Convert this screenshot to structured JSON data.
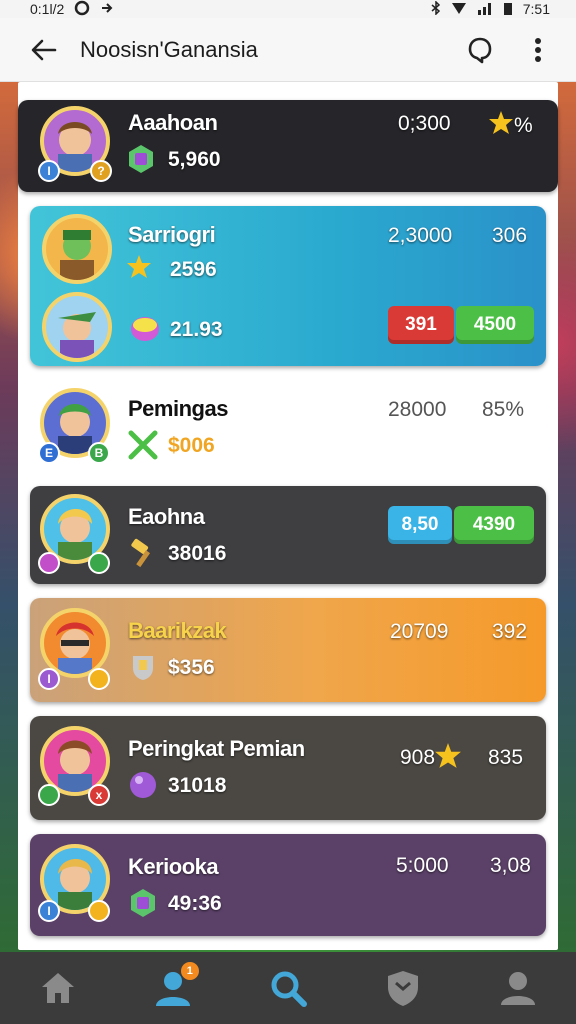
{
  "status_bar": {
    "time": "0:1l/2",
    "battery_text": "7:51"
  },
  "app_bar": {
    "title": "Noosisn'Ganansia"
  },
  "rows": [
    {
      "name": "Aaahoan",
      "sub_value": "5,960",
      "score": "0;300",
      "pct": "%",
      "badge_left": "I",
      "badge_right": "?"
    },
    {
      "name": "Sarriogri",
      "sub_value": "2596",
      "score": "2,3000",
      "pct": "306",
      "sub2_value": "21.93",
      "pill_red": "391",
      "pill_green": "4500",
      "badge_left": "",
      "badge_right": ""
    },
    {
      "name": "Pemingas",
      "sub_value": "$006",
      "score": "28000",
      "pct": "85%",
      "badge_left": "E",
      "badge_right": "B"
    },
    {
      "name": "Eaohna",
      "sub_value": "38016",
      "pill_blue": "8,50",
      "pill_green": "4390",
      "badge_left": "",
      "badge_right": ""
    },
    {
      "name": "Baarikzak",
      "sub_value": "$356",
      "score": "20709",
      "pct": "392",
      "badge_left": "I",
      "badge_right": ""
    },
    {
      "name": "Peringkat Pemian",
      "sub_value": "31018",
      "score": "908",
      "pct": "835",
      "badge_left": "",
      "badge_right": "x"
    },
    {
      "name": "Keriooka",
      "sub_value": "49:36",
      "score": "5:000",
      "pct": "3,08",
      "badge_left": "I",
      "badge_right": ""
    }
  ],
  "nav": {
    "profile_badge": "1"
  },
  "colors": {
    "accent": "#2aa9cf",
    "gold": "#f5d36b",
    "nav_active": "#43a7d8"
  }
}
